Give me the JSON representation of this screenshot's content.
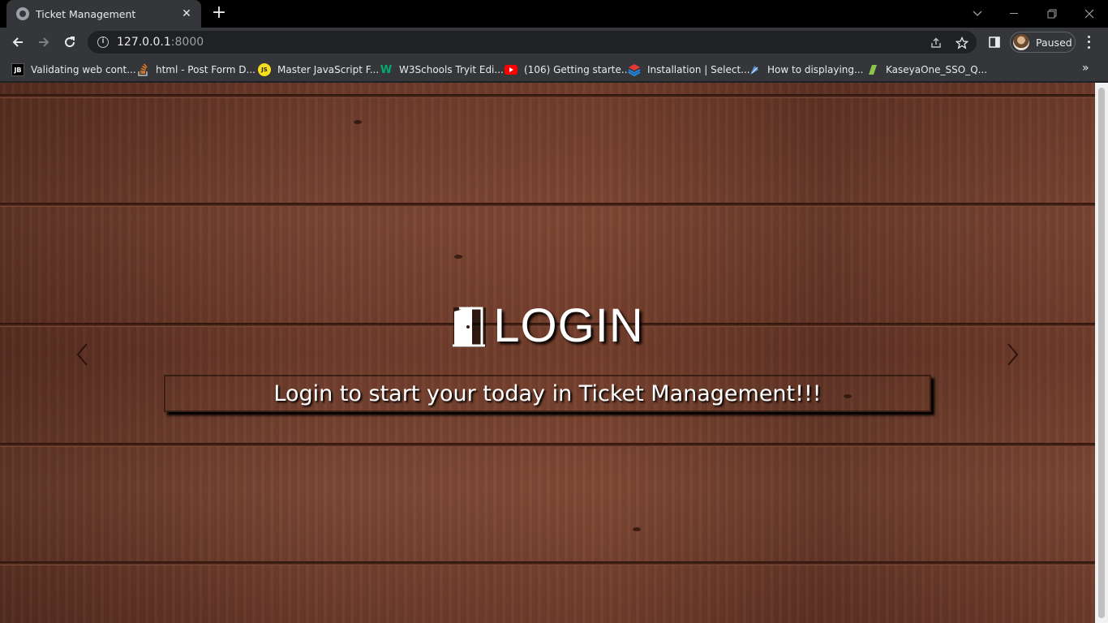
{
  "browser": {
    "tab": {
      "title": "Ticket Management"
    },
    "address": {
      "host": "127.0.0.1",
      "port": ":8000"
    },
    "profile": {
      "status": "Paused"
    },
    "bookmarks": [
      {
        "label": "Validating web cont...",
        "icon": "jetbrains-icon"
      },
      {
        "label": "html - Post Form D...",
        "icon": "stackoverflow-icon"
      },
      {
        "label": "Master JavaScript F...",
        "icon": "javascript-icon"
      },
      {
        "label": "W3Schools Tryit Edi...",
        "icon": "w3schools-icon"
      },
      {
        "label": "(106) Getting starte...",
        "icon": "youtube-icon"
      },
      {
        "label": "Installation | Select...",
        "icon": "selenium-icon"
      },
      {
        "label": "How to displaying...",
        "icon": "bookmark-icon"
      },
      {
        "label": "KaseyaOne_SSO_Q...",
        "icon": "kaseya-icon"
      }
    ]
  },
  "page": {
    "hero": {
      "title": "LOGIN",
      "subtitle": "Login to start your today in Ticket Management!!!"
    }
  },
  "colors": {
    "tabstrip": "#000000",
    "toolbar": "#35363a",
    "omnibox": "#202124",
    "wood_base": "#6b3a2a"
  }
}
